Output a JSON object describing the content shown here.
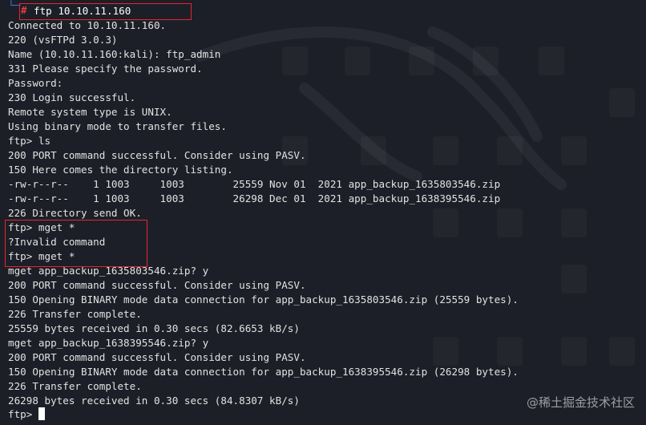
{
  "terminal": {
    "prompt": {
      "corner_glyph": "└─",
      "hash_glyph": "#",
      "command": "ftp 10.10.11.160"
    },
    "lines": [
      "Connected to 10.10.11.160.",
      "220 (vsFTPd 3.0.3)",
      "Name (10.10.11.160:kali): ftp_admin",
      "331 Please specify the password.",
      "Password:",
      "230 Login successful.",
      "Remote system type is UNIX.",
      "Using binary mode to transfer files.",
      "ftp> ls",
      "200 PORT command successful. Consider using PASV.",
      "150 Here comes the directory listing.",
      "-rw-r--r--    1 1003     1003        25559 Nov 01  2021 app_backup_1635803546.zip",
      "-rw-r--r--    1 1003     1003        26298 Dec 01  2021 app_backup_1638395546.zip",
      "226 Directory send OK.",
      "ftp> mget *",
      "?Invalid command",
      "ftp> mget *",
      "mget app_backup_1635803546.zip? y",
      "200 PORT command successful. Consider using PASV.",
      "150 Opening BINARY mode data connection for app_backup_1635803546.zip (25559 bytes).",
      "226 Transfer complete.",
      "25559 bytes received in 0.30 secs (82.6653 kB/s)",
      "mget app_backup_1638395546.zip? y",
      "200 PORT command successful. Consider using PASV.",
      "150 Opening BINARY mode data connection for app_backup_1638395546.zip (26298 bytes).",
      "226 Transfer complete.",
      "26298 bytes received in 0.30 secs (84.8307 kB/s)",
      "ftp> "
    ]
  },
  "watermark": {
    "text": "@稀土掘金技术社区"
  },
  "colors": {
    "background": "#1c1f27",
    "text": "#e2e2e2",
    "highlight_border": "#e6252d",
    "prompt_corner": "#3f72d6",
    "prompt_hash": "#e43d3d"
  }
}
